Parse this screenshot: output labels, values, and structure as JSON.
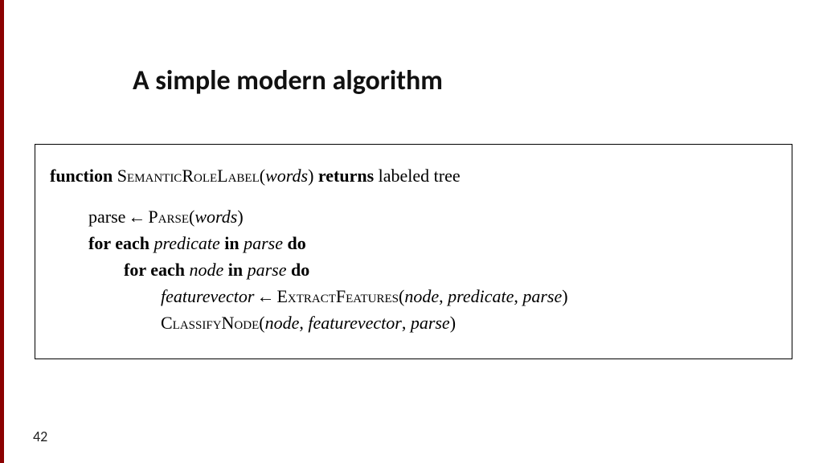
{
  "title": "A simple modern algorithm",
  "page_number": "42",
  "algo": {
    "kw_function": "function",
    "fn_name": "SemanticRoleLabel",
    "arg_words": "words",
    "kw_returns": "returns",
    "ret_val": "labeled tree",
    "var_parse": "parse",
    "arrow": "←",
    "fn_parse": "Parse",
    "kw_foreach": "for each",
    "var_predicate": "predicate",
    "kw_in": "in",
    "kw_do": "do",
    "var_node": "node",
    "var_featurevector": "featurevector",
    "fn_extract": "ExtractFeatures",
    "fn_classify": "ClassifyNode",
    "comma": ", ",
    "lp": "(",
    "rp": ")"
  }
}
